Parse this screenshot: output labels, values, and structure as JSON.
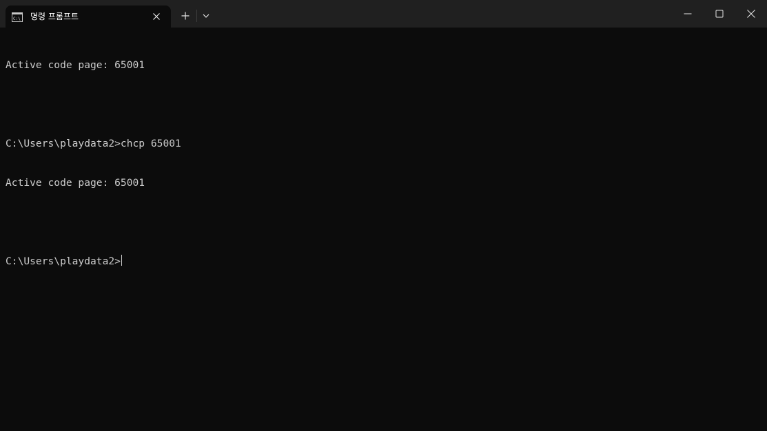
{
  "tab": {
    "title": "명령 프롬프트",
    "icon": "command-prompt-icon"
  },
  "titlebar_buttons": {
    "new_tab": "plus-icon",
    "dropdown": "chevron-down-icon",
    "minimize": "minimize-icon",
    "maximize": "maximize-icon",
    "close": "close-icon"
  },
  "terminal": {
    "lines": [
      "Active code page: 65001",
      "",
      "C:\\Users\\playdata2>chcp 65001",
      "Active code page: 65001",
      "",
      "C:\\Users\\playdata2>"
    ]
  },
  "colors": {
    "background": "#0c0c0c",
    "titlebar": "#202020",
    "text": "#cccccc"
  }
}
